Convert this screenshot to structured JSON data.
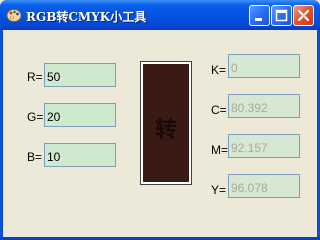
{
  "window": {
    "title": "RGB转CMYK小工具",
    "icon": "palette-icon",
    "controls": [
      "minimize-icon",
      "maximize-icon",
      "close-icon"
    ]
  },
  "rgb": {
    "r_label": "R=",
    "r_value": "50",
    "g_label": "G=",
    "g_value": "20",
    "b_label": "B=",
    "b_value": "10"
  },
  "convert_button": {
    "label": "转",
    "color": "#3a1a14"
  },
  "cmyk": {
    "k_label": "K=",
    "k_value": "0",
    "c_label": "C=",
    "c_value": "80.392",
    "m_label": "M=",
    "m_value": "92.157",
    "y_label": "Y=",
    "y_value": "96.078"
  }
}
